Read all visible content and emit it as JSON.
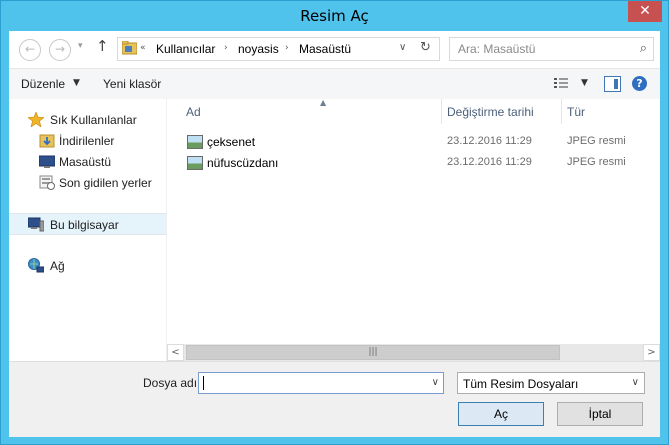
{
  "window": {
    "title": "Resim Aç",
    "close_glyph": "✕"
  },
  "nav": {
    "back_glyph": "←",
    "forward_glyph": "→",
    "recent_glyph": "▾",
    "up_glyph": "↑",
    "breadcrumb": {
      "overflow": "«",
      "items": [
        "Kullanıcılar",
        "noyasis",
        "Masaüstü"
      ],
      "separator": "›"
    },
    "address_dropdown_glyph": "∨",
    "refresh_glyph": "↻",
    "search": {
      "placeholder": "Ara: Masaüstü",
      "icon_glyph": "⌕"
    }
  },
  "toolbar": {
    "organize_label": "Düzenle",
    "organize_caret": "▼",
    "new_folder_label": "Yeni klasör",
    "view_caret": "▼",
    "help_glyph": "?"
  },
  "sidebar": {
    "items": [
      {
        "label": "Sık Kullanılanlar",
        "icon": "star-icon"
      },
      {
        "label": "İndirilenler",
        "icon": "downloads-folder-icon"
      },
      {
        "label": "Masaüstü",
        "icon": "desktop-icon"
      },
      {
        "label": "Son gidilen yerler",
        "icon": "recent-places-icon"
      },
      {
        "label": "Bu bilgisayar",
        "icon": "computer-icon",
        "selected": true
      },
      {
        "label": "Ağ",
        "icon": "network-icon"
      }
    ]
  },
  "file_list": {
    "sort_arrow": "▲",
    "columns": [
      "Ad",
      "Değiştirme tarihi",
      "Tür"
    ],
    "rows": [
      {
        "name": "çeksenet",
        "date": "23.12.2016 11:29",
        "type": "JPEG resmi"
      },
      {
        "name": "nüfuscüzdanı",
        "date": "23.12.2016 11:29",
        "type": "JPEG resmi"
      }
    ]
  },
  "scrollbar": {
    "left_glyph": "<",
    "right_glyph": ">",
    "grip_glyph": "|||"
  },
  "footer": {
    "filename_label": "Dosya adı:",
    "filename_value": "",
    "filename_dropdown_glyph": "∨",
    "filter_value": "Tüm Resim Dosyaları",
    "filter_dropdown_glyph": "∨",
    "open_label": "Aç",
    "cancel_label": "İptal"
  },
  "colors": {
    "title_bar": "#4fc3ec",
    "close_button": "#c75050",
    "selection": "#e5f3fb",
    "header_text": "#4c607a"
  }
}
